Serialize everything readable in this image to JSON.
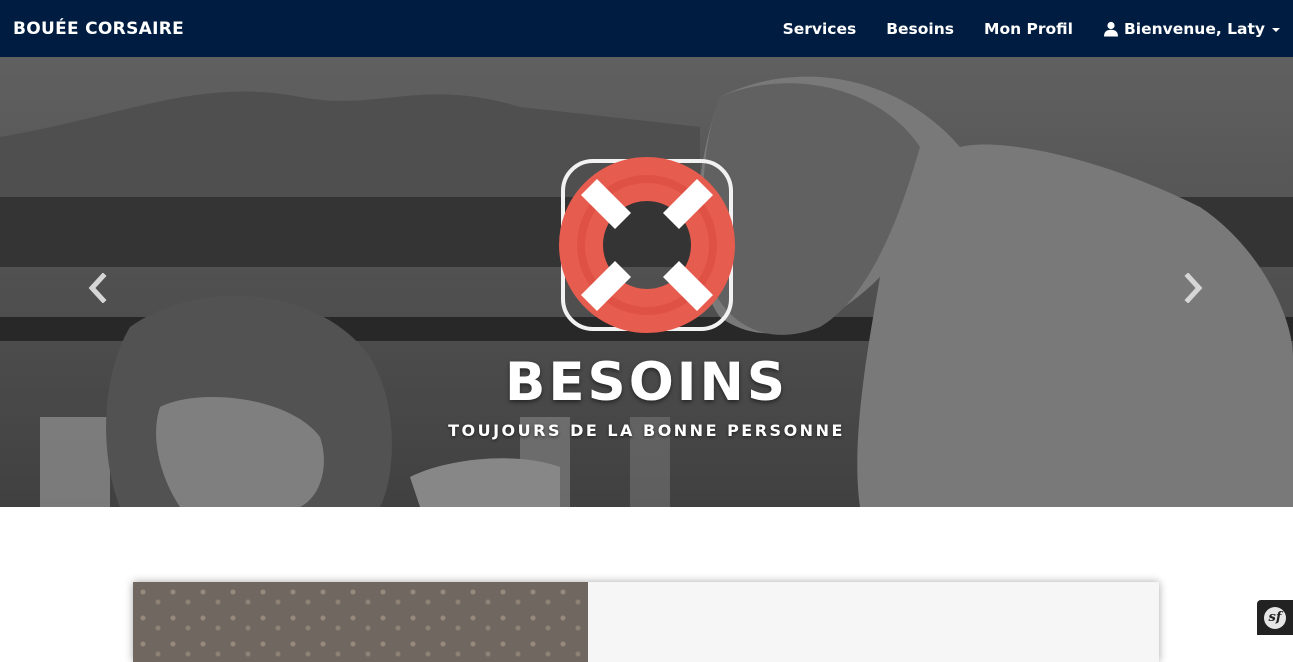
{
  "navbar": {
    "brand": "BOUÉE CORSAIRE",
    "items": [
      {
        "label": "Services"
      },
      {
        "label": "Besoins"
      },
      {
        "label": "Mon Profil"
      }
    ],
    "user_menu": {
      "label": "Bienvenue, Laty",
      "icon": "user-icon"
    }
  },
  "hero": {
    "title": "BESOINS",
    "subtitle": "TOUJOURS DE LA BONNE PERSONNE",
    "icon": "lifebuoy-icon",
    "prev_icon": "chevron-left-icon",
    "next_icon": "chevron-right-icon"
  },
  "toolbar": {
    "logo_text": "sf"
  },
  "colors": {
    "navbar_bg": "#001d41",
    "buoy_red": "#e65c4f",
    "buoy_white": "#ffffff"
  }
}
